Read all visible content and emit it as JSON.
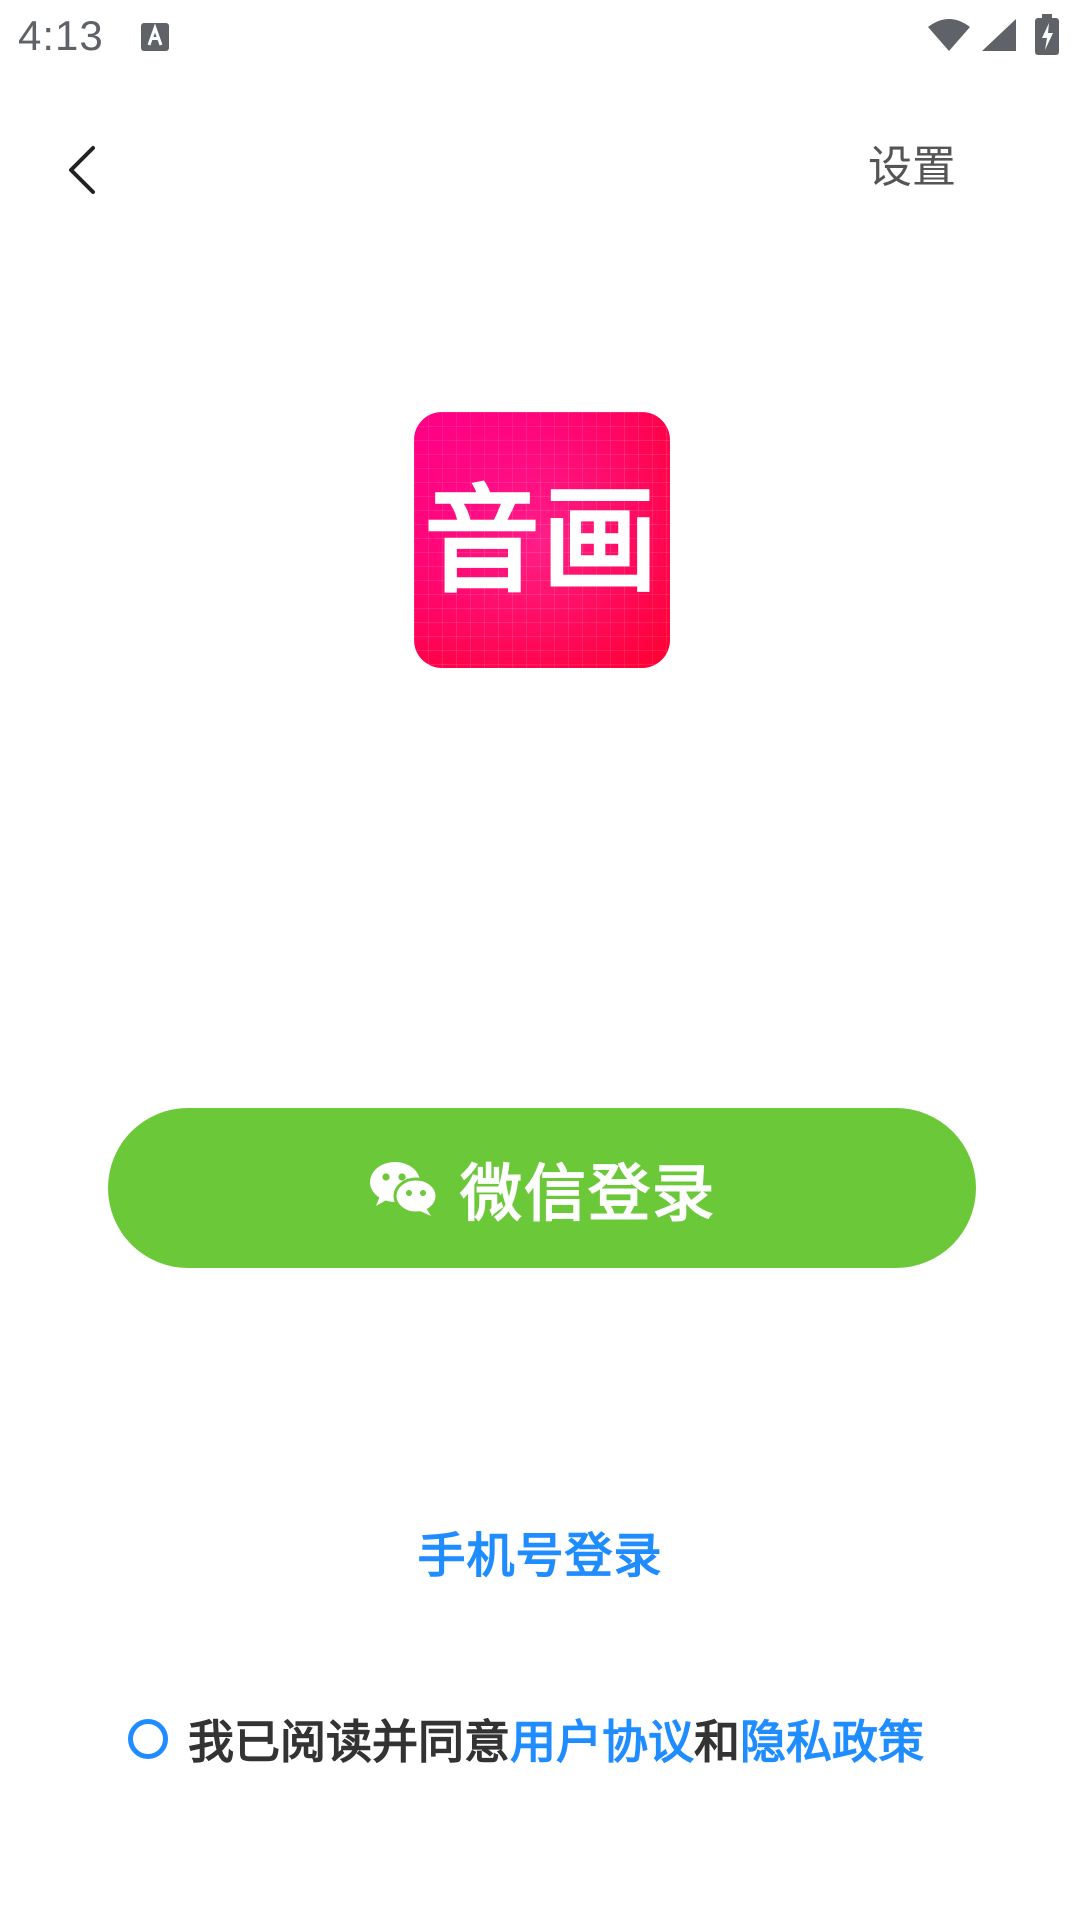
{
  "status_bar": {
    "time": "4:13",
    "icons": [
      "a-notification-icon",
      "wifi-icon",
      "signal-icon",
      "battery-charging-icon"
    ]
  },
  "nav": {
    "back_icon": "chevron-left-icon",
    "settings_label": "设置"
  },
  "logo": {
    "text": "音画",
    "colors": [
      "#ff00cc",
      "#ff0a64",
      "#ff0033"
    ]
  },
  "wechat_login": {
    "icon": "wechat-icon",
    "label": "微信登录",
    "color": "#6ac839"
  },
  "phone_login": {
    "label": "手机号登录",
    "color": "#1f8cff"
  },
  "agreement": {
    "prefix": "我已阅读并同意",
    "user_agreement": "用户协议",
    "conjunction": "和",
    "privacy_policy": "隐私政策",
    "checked": false
  }
}
